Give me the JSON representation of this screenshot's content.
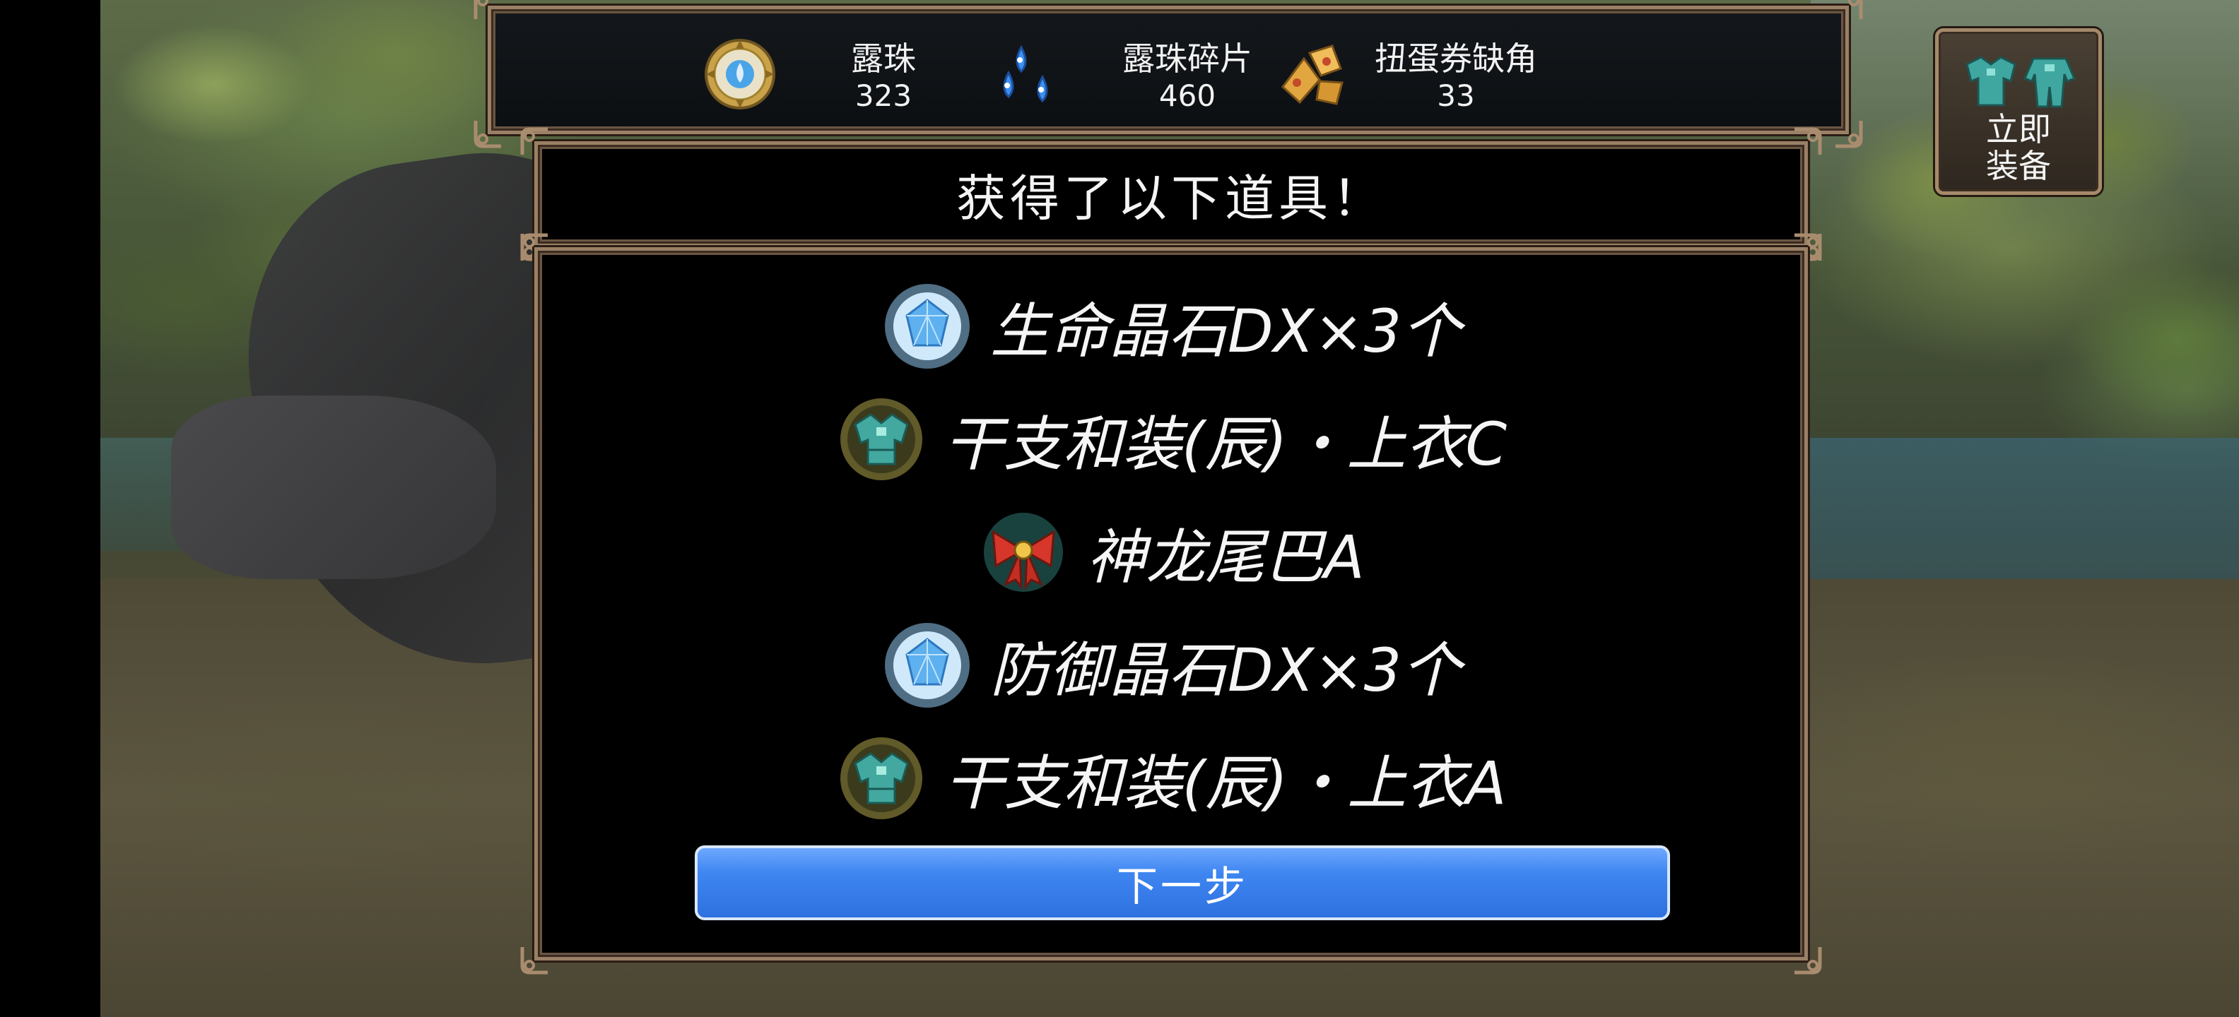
{
  "currencies": [
    {
      "label": "露珠",
      "value": "323",
      "icon": "dew-orb-icon"
    },
    {
      "label": "露珠碎片",
      "value": "460",
      "icon": "dew-fragment-icon"
    },
    {
      "label": "扭蛋券缺角",
      "value": "33",
      "icon": "gacha-ticket-fragment-icon"
    }
  ],
  "equip_button": {
    "label": "立即\n装备",
    "icon": "armor-icon"
  },
  "dialog": {
    "title": "获得了以下道具！",
    "items": [
      {
        "name": "生命晶石DX×3个",
        "icon": "blue-crystal-icon"
      },
      {
        "name": "干支和装(辰)・上衣C",
        "icon": "armor-top-icon"
      },
      {
        "name": "神龙尾巴A",
        "icon": "red-bow-icon"
      },
      {
        "name": "防御晶石DX×3个",
        "icon": "blue-crystal-icon"
      },
      {
        "name": "干支和装(辰)・上衣A",
        "icon": "armor-top-icon"
      }
    ],
    "next_label": "下一步"
  }
}
